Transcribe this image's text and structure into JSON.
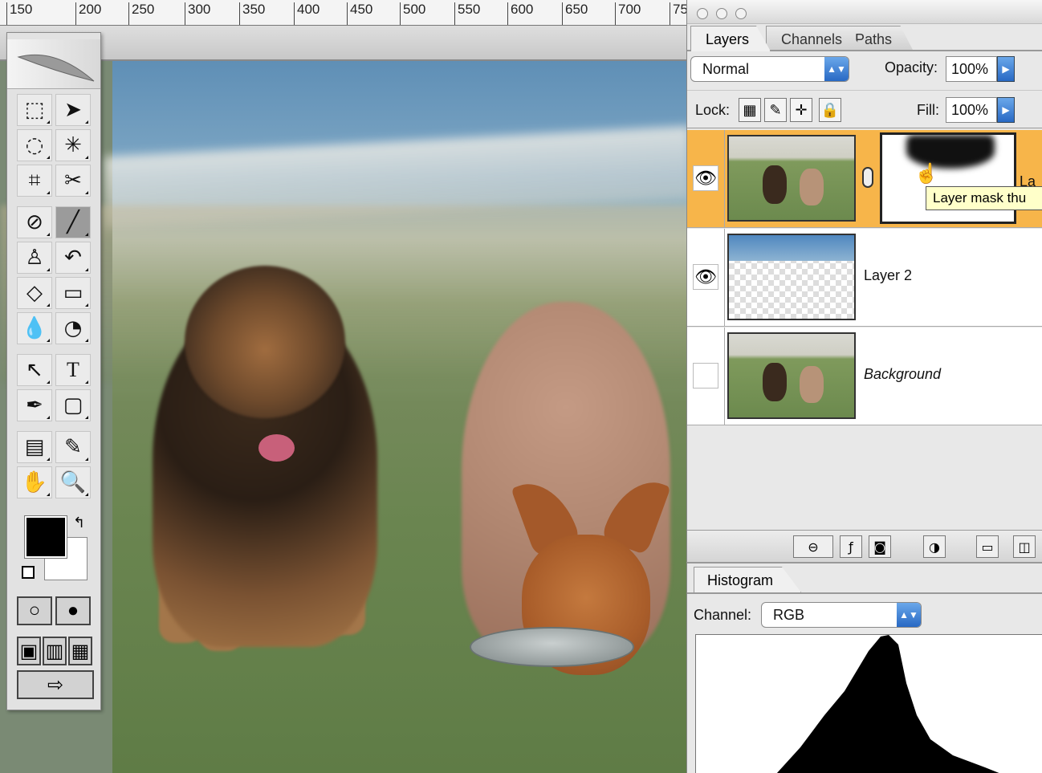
{
  "ruler": {
    "labels": [
      "150",
      "200",
      "250",
      "300",
      "350",
      "400",
      "450",
      "500",
      "550",
      "600",
      "650",
      "700",
      "75"
    ]
  },
  "layers_palette": {
    "tabs": [
      {
        "label": "Layers"
      },
      {
        "label": "Channels"
      },
      {
        "label": "Paths"
      }
    ],
    "blend_mode": "Normal",
    "opacity_label": "Opacity:",
    "opacity_value": "100%",
    "lock_label": "Lock:",
    "fill_label": "Fill:",
    "fill_value": "100%",
    "layers": [
      {
        "name": "La",
        "visible": true,
        "selected": true,
        "has_mask": true
      },
      {
        "name": "Layer 2",
        "visible": true,
        "selected": false
      },
      {
        "name": "Background",
        "visible": false,
        "selected": false,
        "italic": true
      }
    ],
    "tooltip": "Layer mask thu"
  },
  "histogram": {
    "tab": "Histogram",
    "channel_label": "Channel:",
    "channel_value": "RGB"
  },
  "icons": {
    "eye": "eye-icon",
    "chain": "link-icon"
  }
}
